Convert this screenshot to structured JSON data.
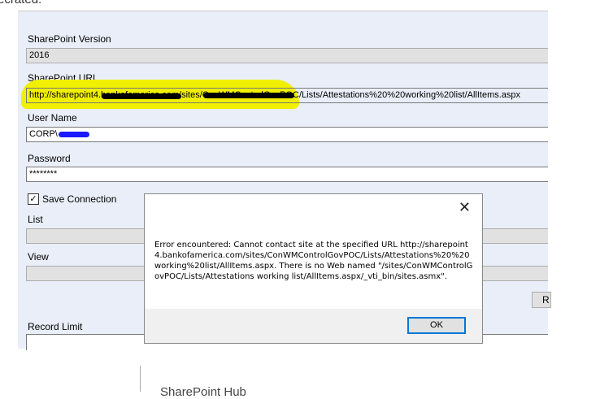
{
  "background_text": "ecrated:",
  "form": {
    "version_label": "SharePoint Version",
    "version_value": "2016",
    "url_label": "SharePoint URL",
    "url_value": "http://sharepoint4.bankofamerica.com/sites/ConWMControlGovPOC/Lists/Attestations%20%20working%20list/AllItems.aspx",
    "user_label": "User Name",
    "user_value": "CORP\\",
    "password_label": "Password",
    "password_value": "********",
    "save_label": "Save Connection",
    "save_checked": true,
    "list_label": "List",
    "view_label": "View",
    "button_partial": "R",
    "record_label": "Record Limit"
  },
  "dialog": {
    "message": "Error encountered: Cannot contact site at the specified URL http://sharepoint4.bankofamerica.com/sites/ConWMControlGovPOC/Lists/Attestations%20%20working%20list/AllItems.aspx. There is no Web named \"/sites/ConWMControlGovPOC/Lists/Attestations  working list/AllItems.aspx/_vti_bin/sites.asmx\".",
    "ok_label": "OK",
    "close_glyph": "✕"
  },
  "footer_text": "SharePoint Hub"
}
